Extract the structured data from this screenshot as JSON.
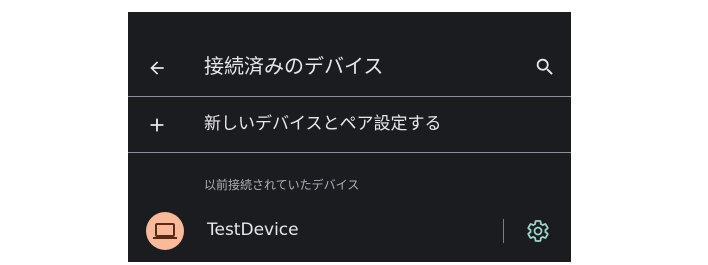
{
  "app_bar": {
    "back_icon": "arrow-left-icon",
    "title": "接続済みのデバイス",
    "search_icon": "search-icon"
  },
  "pair_new": {
    "icon": "plus-icon",
    "label": "新しいデバイスとペア設定する"
  },
  "previously_connected": {
    "header": "以前接続されていたデバイス",
    "devices": [
      {
        "name": "TestDevice",
        "icon": "laptop-icon",
        "settings_icon": "gear-icon"
      }
    ]
  },
  "colors": {
    "background": "#1b1c20",
    "text_primary": "#e8e7ec",
    "text_secondary": "#aeb0b8",
    "avatar_bg": "#f9b99b",
    "avatar_icon": "#5a2a18",
    "settings_accent": "#9fd4c9"
  }
}
